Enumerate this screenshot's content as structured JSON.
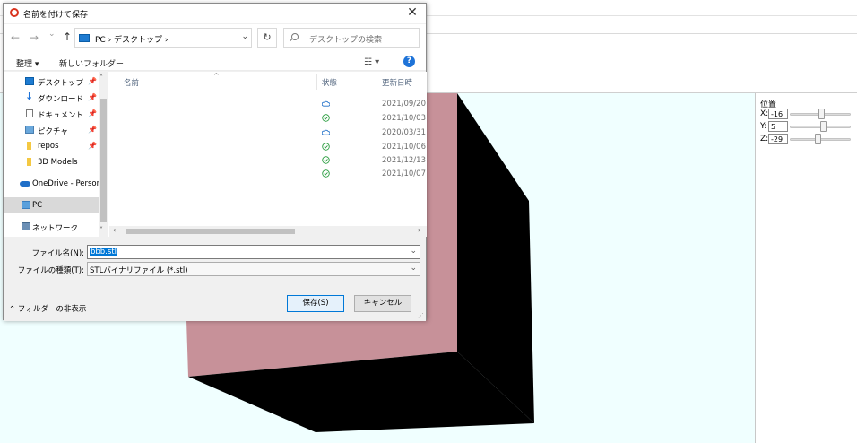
{
  "dialog": {
    "title": "名前を付けて保存",
    "close_glyph": "✕",
    "nav": {
      "back_glyph": "←",
      "forward_glyph": "→",
      "recent_glyph": "⌄",
      "up_glyph": "↑",
      "address_path": "PC  ›  デスクトップ  ›",
      "address_dropdown_glyph": "⌄",
      "refresh_glyph": "↻",
      "search_placeholder": "デスクトップの検索"
    },
    "commands": {
      "organize": "整理 ▾",
      "new_folder": "新しいフォルダー",
      "view_glyph": "☷ ▾",
      "help_glyph": "?"
    },
    "nav_pane": {
      "items": [
        {
          "label": "デスクトップ",
          "pinned": true,
          "icon": "desktop-icon"
        },
        {
          "label": "ダウンロード",
          "pinned": true,
          "icon": "download-icon"
        },
        {
          "label": "ドキュメント",
          "pinned": true,
          "icon": "document-icon"
        },
        {
          "label": "ピクチャ",
          "pinned": true,
          "icon": "picture-icon"
        },
        {
          "label": "repos",
          "pinned": true,
          "icon": "folder-icon"
        },
        {
          "label": "3D Models",
          "pinned": false,
          "icon": "folder-icon"
        },
        {
          "label": "OneDrive - Person",
          "pinned": false,
          "icon": "cloud-icon"
        },
        {
          "label": "PC",
          "pinned": false,
          "icon": "pc-icon",
          "selected": true
        },
        {
          "label": "ネットワーク",
          "pinned": false,
          "icon": "network-icon"
        }
      ],
      "pin_glyph": "📌",
      "scroll_up_glyph": "˄",
      "scroll_down_glyph": "˅"
    },
    "file_list": {
      "columns": {
        "name": "名前",
        "status": "状態",
        "modified": "更新日時"
      },
      "sort_glyph": "^",
      "rows": [
        {
          "status": "cloud",
          "date": "2021/09/20"
        },
        {
          "status": "synced",
          "date": "2021/10/03"
        },
        {
          "status": "cloud",
          "date": "2020/03/31"
        },
        {
          "status": "synced",
          "date": "2021/10/06"
        },
        {
          "status": "synced",
          "date": "2021/12/13"
        },
        {
          "status": "synced",
          "date": "2021/10/07"
        }
      ],
      "hscroll_left_glyph": "‹",
      "hscroll_right_glyph": "›"
    },
    "form": {
      "filename_label": "ファイル名(N):",
      "filename_value": "bbb.stl",
      "filetype_label": "ファイルの種類(T):",
      "filetype_value": "STLバイナリファイル (*.stl)",
      "dropdown_glyph": "⌄",
      "hide_folders": "⌃  フォルダーの非表示",
      "save_button": "保存(S)",
      "cancel_button": "キャンセル",
      "grip_glyph": "⋰"
    }
  },
  "side_panel": {
    "title": "位置",
    "coords": [
      {
        "label": "X:",
        "value": "-16",
        "slider_fraction": 0.52
      },
      {
        "label": "Y:",
        "value": "5",
        "slider_fraction": 0.56
      },
      {
        "label": "Z:",
        "value": "-29",
        "slider_fraction": 0.45
      }
    ]
  },
  "colors": {
    "viewport_bg": "#f0ffff",
    "cube_pink": "#c79199",
    "cube_black": "#000000",
    "accent": "#0078d7",
    "status_green": "#2a9d3f",
    "status_cloud": "#1f6fc8"
  }
}
